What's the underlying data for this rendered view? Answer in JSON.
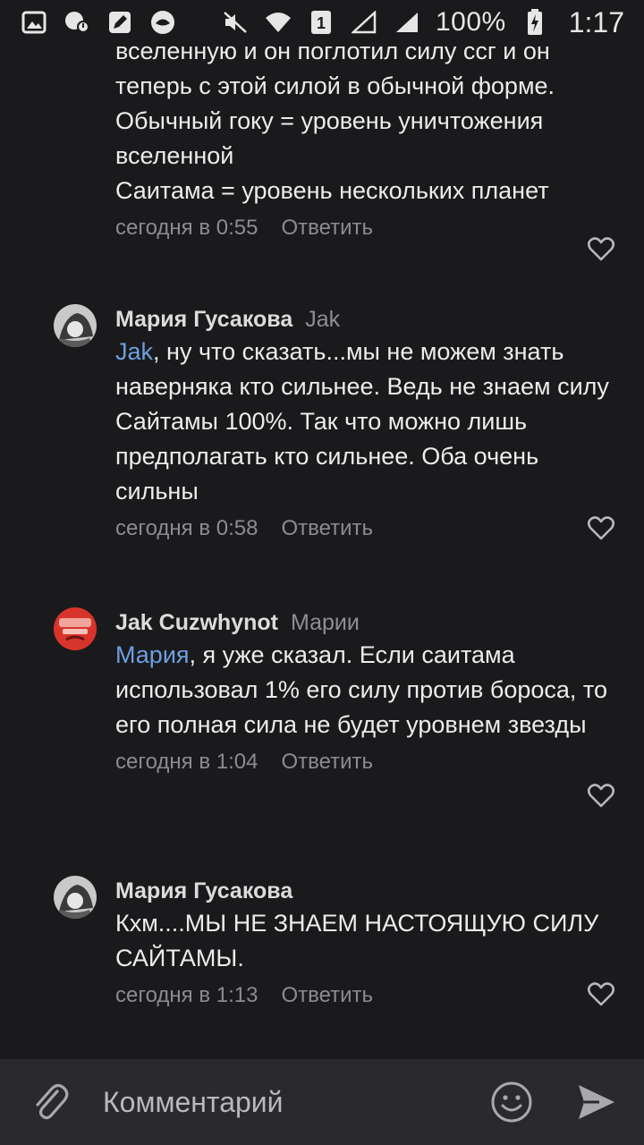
{
  "status_bar": {
    "battery": "100%",
    "time": "1:17",
    "sim_slot": "1"
  },
  "comments": [
    {
      "author": "",
      "reply_to": "",
      "mention": "",
      "text": "вселенную и он поглотил силу ссг и он теперь с этой силой в обычной форме.\nОбычный гоку = уровень уничтожения вселенной\nСаитама = уровень нескольких планет",
      "time": "сегодня в 0:55",
      "reply_label": "Ответить"
    },
    {
      "author": "Мария Гусакова",
      "reply_to": "Jak",
      "mention": "Jak",
      "text": ", ну что сказать...мы не можем знать наверняка кто сильнее. Ведь не знаем силу Сайтамы 100%. Так что можно лишь предполагать кто сильнее. Оба очень сильны",
      "time": "сегодня в 0:58",
      "reply_label": "Ответить"
    },
    {
      "author": "Jak Cuzwhynot",
      "reply_to": "Марии",
      "mention": "Мария",
      "text": ", я уже сказал. Если саитама использовал 1% его силу против бороса, то его полная сила не будет уровнем звезды",
      "time": "сегодня в 1:04",
      "reply_label": "Ответить"
    },
    {
      "author": "Мария Гусакова",
      "reply_to": "",
      "mention": "",
      "text": "Кхм....МЫ НЕ ЗНАЕМ НАСТОЯЩУЮ СИЛУ САЙТАМЫ.",
      "time": "сегодня в 1:13",
      "reply_label": "Ответить"
    }
  ],
  "composer": {
    "placeholder": "Комментарий"
  },
  "colors": {
    "background": "#1a1a1c",
    "mention": "#6e9fe0",
    "composer_bg": "#2a2a2c"
  }
}
